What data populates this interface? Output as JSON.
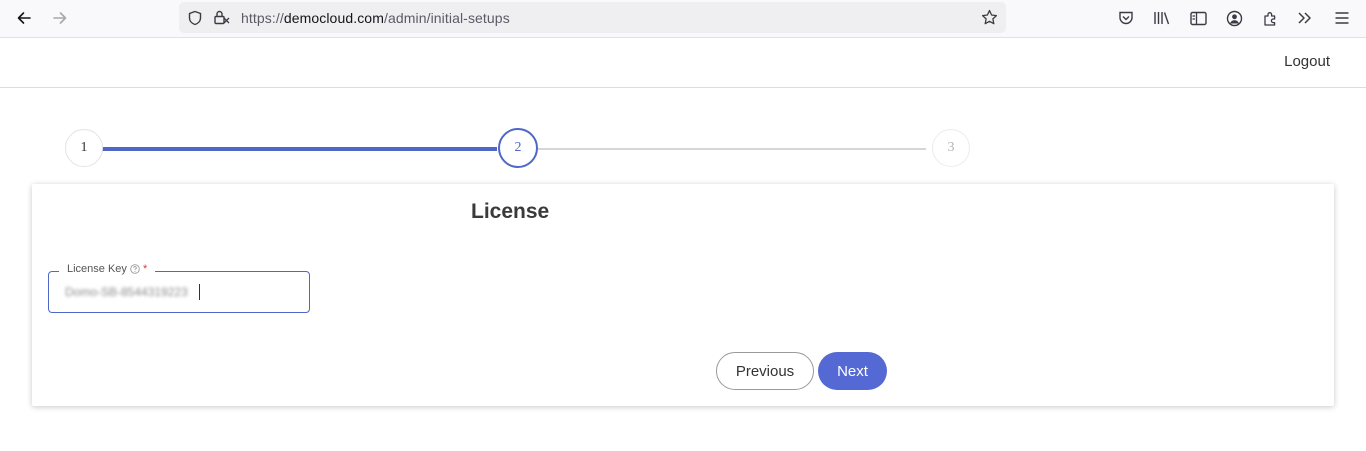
{
  "browser": {
    "url_scheme": "https://",
    "url_host": "democloud.com",
    "url_path": "/admin/initial-setups"
  },
  "header": {
    "logout_label": "Logout"
  },
  "stepper": {
    "steps": [
      "1",
      "2",
      "3"
    ],
    "current_step": 2,
    "accent_color": "#4f67c7"
  },
  "card": {
    "title": "License",
    "license_field": {
      "label": "License Key",
      "required_mark": "*",
      "value": "Domo-SB-8544319223"
    },
    "previous_label": "Previous",
    "next_label": "Next"
  }
}
